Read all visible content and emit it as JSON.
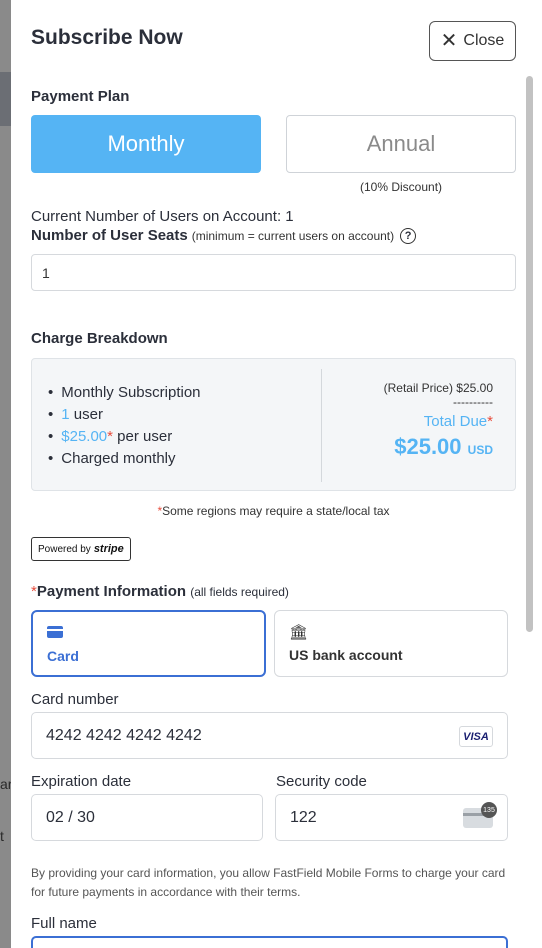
{
  "background": {
    "fragment_1": "ar",
    "fragment_2": "t"
  },
  "modal": {
    "title": "Subscribe Now",
    "close_label": "Close",
    "close_icon": "close-icon"
  },
  "payment_plan": {
    "label": "Payment Plan",
    "monthly_label": "Monthly",
    "annual_label": "Annual",
    "annual_note": "(10% Discount)",
    "selected": "Monthly",
    "accent_color": "#55b4f4"
  },
  "users": {
    "current_text": "Current Number of Users on Account: 1",
    "seats_label": "Number of User Seats",
    "seats_hint": "(minimum = current users on account)",
    "help_icon": "question-circle-icon",
    "seats_value": "1"
  },
  "breakdown": {
    "label": "Charge Breakdown",
    "item_1": "Monthly Subscription",
    "item_2_count": "1",
    "item_2_suffix": " user",
    "item_3_price": "$25.00",
    "item_3_star": "*",
    "item_3_suffix": " per user",
    "item_4": "Charged monthly",
    "retail": "(Retail Price) $25.00",
    "dashes": "----------",
    "total_due_label": "Total Due",
    "total_due_star": "*",
    "total_amount": "$25.00",
    "currency": "USD"
  },
  "tax_note": {
    "star": "*",
    "text": "Some regions may require a state/local tax"
  },
  "stripe": {
    "powered_by": "Powered by",
    "brand": "stripe"
  },
  "payment_info": {
    "star": "*",
    "label": "Payment Information",
    "hint": "(all fields required)",
    "methods": [
      {
        "label": "Card",
        "icon": "credit-card-icon",
        "selected": true
      },
      {
        "label": "US bank account",
        "icon": "bank-icon",
        "selected": false
      }
    ]
  },
  "card": {
    "number_label": "Card number",
    "number_value": "4242 4242 4242 4242",
    "brand_badge": "VISA",
    "expiry_label": "Expiration date",
    "expiry_value": "02 / 30",
    "cvc_label": "Security code",
    "cvc_value": "122",
    "cvc_icon_number": "135"
  },
  "consent": {
    "text": "By providing your card information, you allow FastField Mobile Forms to charge your card for future payments in accordance with their terms."
  },
  "full_name": {
    "label": "Full name",
    "value": ""
  }
}
